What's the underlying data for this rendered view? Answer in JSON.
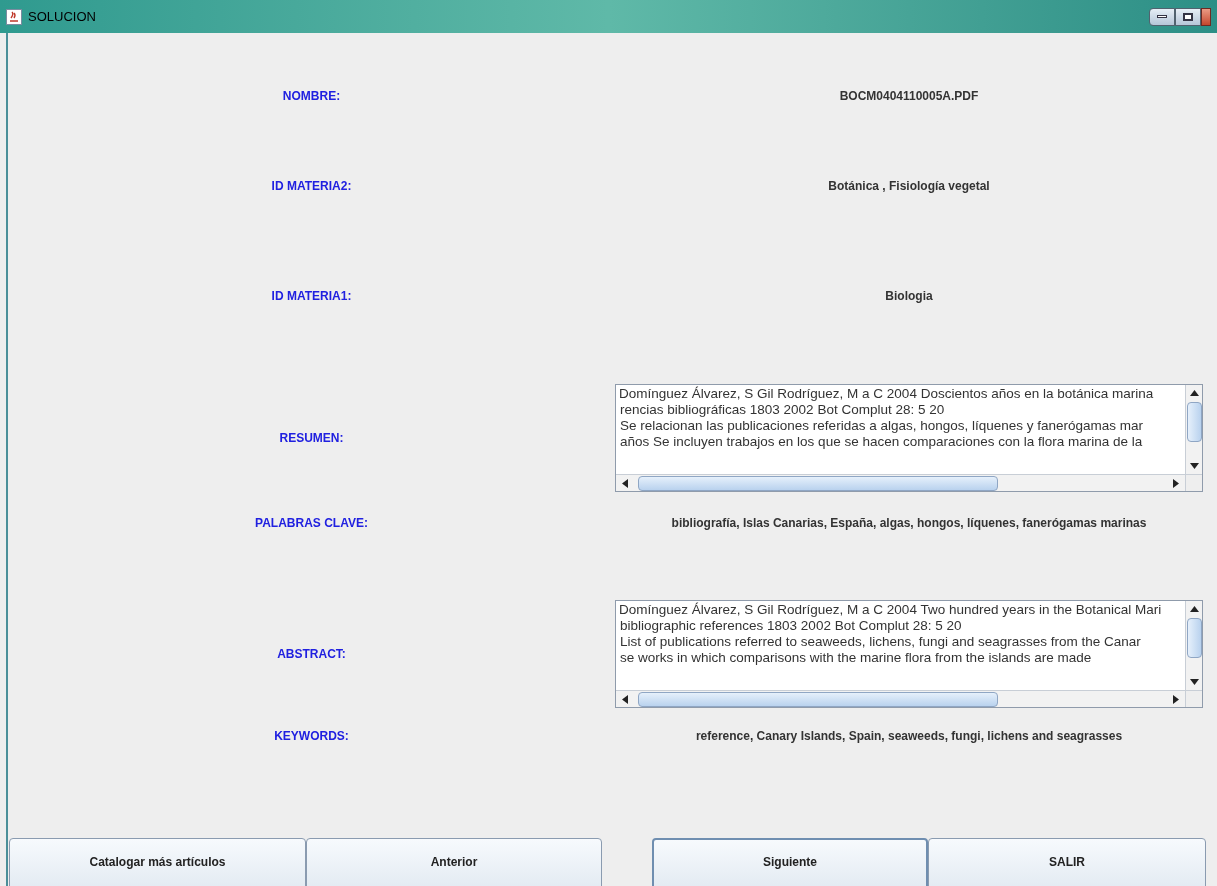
{
  "window": {
    "title": "SOLUCION"
  },
  "fields": [
    {
      "kind": "text",
      "label": "NOMBRE:",
      "value": "BOCM0404110005A.PDF"
    },
    {
      "kind": "text",
      "label": "ID MATERIA2:",
      "value": "Botánica , Fisiología vegetal"
    },
    {
      "kind": "text",
      "label": "ID MATERIA1:",
      "value": "Biologia"
    },
    {
      "kind": "area",
      "label": "RESUMEN:",
      "lines": [
        "Domínguez Álvarez, S Gil Rodríguez, M a C 2004 Doscientos años en la botánica marina",
        "rencias bibliográficas 1803 2002 Bot Complut 28: 5 20",
        "Se relacionan las publicaciones referidas a algas, hongos, líquenes y fanerógamas mar",
        "años Se incluyen trabajos en los que se hacen comparaciones con la flora marina de la"
      ]
    },
    {
      "kind": "text",
      "label": "PALABRAS CLAVE:",
      "value": "bibliografía, Islas Canarias, España, algas, hongos, líquenes, fanerógamas marinas"
    },
    {
      "kind": "area",
      "label": "ABSTRACT:",
      "lines": [
        "Domínguez Álvarez, S Gil Rodríguez, M a C 2004 Two hundred years in the Botanical Mari",
        "bibliographic references 1803 2002 Bot Complut 28: 5 20",
        "List of publications referred to seaweeds, lichens, fungi and seagrasses from the Canar",
        "se works in which comparisons with the marine flora from the islands are made"
      ]
    },
    {
      "kind": "text",
      "label": "KEYWORDS:",
      "value": "reference, Canary Islands, Spain, seaweeds, fungi, lichens and seagrasses"
    }
  ],
  "buttons": [
    {
      "label": "Catalogar más artículos",
      "selected": false
    },
    {
      "label": "Anterior",
      "selected": false
    },
    {
      "label": "Siguiente",
      "selected": true
    },
    {
      "label": "SALIR",
      "selected": false
    }
  ]
}
